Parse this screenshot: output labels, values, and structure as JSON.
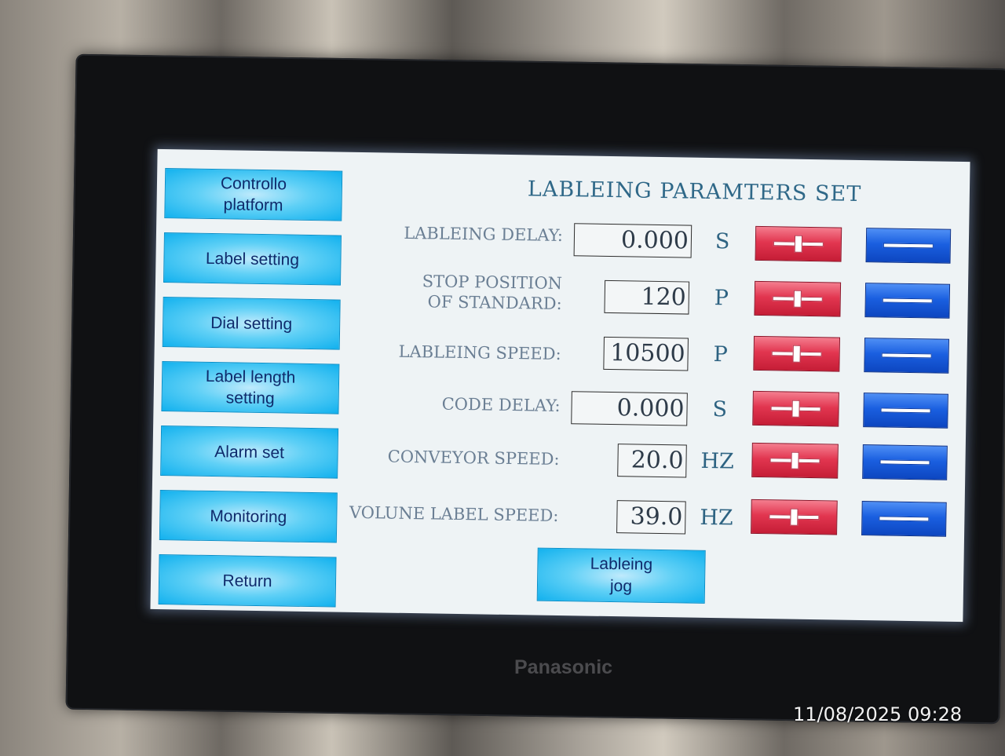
{
  "device": {
    "brand": "Panasonic",
    "photo_timestamp": "11/08/2025 09:28"
  },
  "sidebar": {
    "items": [
      {
        "label": "Controllo\nplatform"
      },
      {
        "label": "Label setting"
      },
      {
        "label": "Dial setting"
      },
      {
        "label": "Label length\nsetting"
      },
      {
        "label": "Alarm set"
      },
      {
        "label": "Monitoring"
      },
      {
        "label": "Return"
      }
    ]
  },
  "main": {
    "title": "LABLEING PARAMTERS SET",
    "params": [
      {
        "label": "LABLEING DELAY:",
        "value": "0.000",
        "unit": "S"
      },
      {
        "label": "STOP POSITION\nOF STANDARD:",
        "value": "120",
        "unit": "P"
      },
      {
        "label": "LABLEING SPEED:",
        "value": "10500",
        "unit": "P"
      },
      {
        "label": "CODE DELAY:",
        "value": "0.000",
        "unit": "S"
      },
      {
        "label": "CONVEYOR SPEED:",
        "value": "20.0",
        "unit": "HZ"
      },
      {
        "label": "VOLUNE LABEL SPEED:",
        "value": "39.0",
        "unit": "HZ"
      }
    ],
    "jog_button": "Lableing\njog"
  },
  "colors": {
    "nav_button": "#12b1ee",
    "plus_button": "#e23650",
    "minus_button": "#1a5fe0",
    "title_text": "#2f6888",
    "screen_bg": "#eef3f5"
  },
  "icons": {
    "increase": "plus-icon",
    "decrease": "minus-icon"
  }
}
